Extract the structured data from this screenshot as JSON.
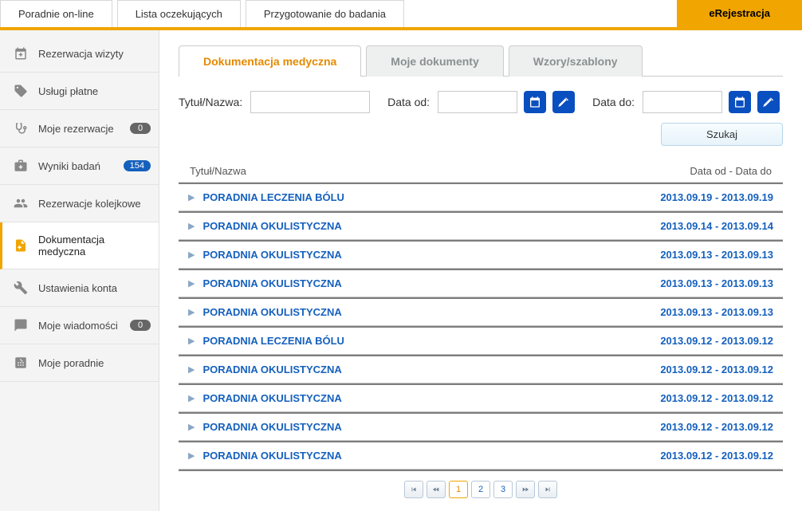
{
  "topnav": {
    "items": [
      "Poradnie on-line",
      "Lista oczekujących",
      "Przygotowanie do badania"
    ],
    "brand": "eRejestracja"
  },
  "sidebar": {
    "items": [
      {
        "label": "Rezerwacja wizyty",
        "icon": "calendar-plus-icon"
      },
      {
        "label": "Usługi płatne",
        "icon": "price-tag-icon"
      },
      {
        "label": "Moje rezerwacje",
        "icon": "stethoscope-icon",
        "badge": "0"
      },
      {
        "label": "Wyniki badań",
        "icon": "briefcase-medical-icon",
        "badge": "154",
        "badge_style": "blue"
      },
      {
        "label": "Rezerwacje kolejkowe",
        "icon": "people-icon"
      },
      {
        "label": "Dokumentacja medyczna",
        "icon": "document-medical-icon",
        "active": true
      },
      {
        "label": "Ustawienia konta",
        "icon": "wrench-icon"
      },
      {
        "label": "Moje wiadomości",
        "icon": "chat-icon",
        "badge": "0"
      },
      {
        "label": "Moje poradnie",
        "icon": "hospital-icon"
      }
    ]
  },
  "tabs": [
    {
      "label": "Dokumentacja medyczna",
      "active": true
    },
    {
      "label": "Moje dokumenty"
    },
    {
      "label": "Wzory/szablony"
    }
  ],
  "filters": {
    "title_label": "Tytuł/Nazwa:",
    "date_from_label": "Data od:",
    "date_to_label": "Data do:",
    "search_label": "Szukaj"
  },
  "table": {
    "header_title": "Tytuł/Nazwa",
    "header_date": "Data od - Data do",
    "rows": [
      {
        "title": "PORADNIA LECZENIA BÓLU",
        "dates": "2013.09.19 - 2013.09.19"
      },
      {
        "title": "PORADNIA OKULISTYCZNA",
        "dates": "2013.09.14 - 2013.09.14"
      },
      {
        "title": "PORADNIA OKULISTYCZNA",
        "dates": "2013.09.13 - 2013.09.13"
      },
      {
        "title": "PORADNIA OKULISTYCZNA",
        "dates": "2013.09.13 - 2013.09.13"
      },
      {
        "title": "PORADNIA OKULISTYCZNA",
        "dates": "2013.09.13 - 2013.09.13"
      },
      {
        "title": "PORADNIA LECZENIA BÓLU",
        "dates": "2013.09.12 - 2013.09.12"
      },
      {
        "title": "PORADNIA OKULISTYCZNA",
        "dates": "2013.09.12 - 2013.09.12"
      },
      {
        "title": "PORADNIA OKULISTYCZNA",
        "dates": "2013.09.12 - 2013.09.12"
      },
      {
        "title": "PORADNIA OKULISTYCZNA",
        "dates": "2013.09.12 - 2013.09.12"
      },
      {
        "title": "PORADNIA OKULISTYCZNA",
        "dates": "2013.09.12 - 2013.09.12"
      }
    ]
  },
  "paginator": {
    "first": "⏮",
    "prev": "◄◄",
    "pages": [
      "1",
      "2",
      "3"
    ],
    "active_page": "1",
    "next": "►►",
    "last": "⏭"
  }
}
